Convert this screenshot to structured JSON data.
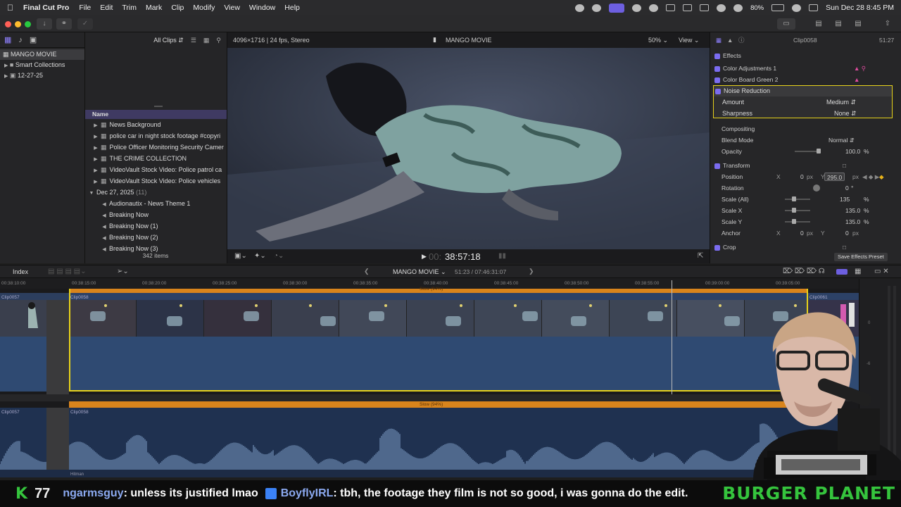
{
  "menubar": {
    "app_name": "Final Cut Pro",
    "items": [
      "File",
      "Edit",
      "Trim",
      "Mark",
      "Clip",
      "Modify",
      "View",
      "Window",
      "Help"
    ],
    "battery": "80%",
    "datetime": "Sun Dec 28  8:45 PM"
  },
  "library": {
    "name": "MANGO MOVIE",
    "items": [
      {
        "label": "Smart Collections"
      },
      {
        "label": "12-27-25"
      }
    ]
  },
  "browser": {
    "filter": "All Clips",
    "column_header": "Name",
    "rows": [
      {
        "label": "News Background",
        "type": "clip"
      },
      {
        "label": "police  car in night stock footage #copyri",
        "type": "clip"
      },
      {
        "label": "Police Officer Monitoring Security Camer",
        "type": "clip"
      },
      {
        "label": "THE CRIME COLLECTION",
        "type": "clip"
      },
      {
        "label": "VideoVault Stock Video:   Police patrol ca",
        "type": "clip"
      },
      {
        "label": "VideoVault Stock Video:   Police vehicles",
        "type": "clip"
      },
      {
        "label": "Dec 27, 2025",
        "count": "(11)",
        "type": "group"
      },
      {
        "label": "Audionautix - News Theme 1",
        "type": "audio"
      },
      {
        "label": "Breaking Now",
        "type": "audio"
      },
      {
        "label": "Breaking Now (1)",
        "type": "audio"
      },
      {
        "label": "Breaking Now (2)",
        "type": "audio"
      },
      {
        "label": "Breaking Now (3)",
        "type": "audio"
      }
    ],
    "item_count": "342 items"
  },
  "viewer": {
    "format": "4096×1716 | 24 fps, Stereo",
    "project": "MANGO MOVIE",
    "zoom": "50%",
    "view_label": "View",
    "timecode_dim": "00:",
    "timecode": "38:57:18"
  },
  "inspector": {
    "clip_name": "Clip0058",
    "clip_duration": "51:27",
    "sections": {
      "effects": "Effects",
      "color_adjustments": "Color Adjustments 1",
      "color_board": "Color Board Green 2",
      "noise_reduction": "Noise Reduction",
      "amount_label": "Amount",
      "amount_value": "Medium",
      "sharpness_label": "Sharpness",
      "sharpness_value": "None",
      "compositing": "Compositing",
      "blend_label": "Blend Mode",
      "blend_value": "Normal",
      "opacity_label": "Opacity",
      "opacity_value": "100.0",
      "transform": "Transform",
      "position_label": "Position",
      "pos_x": "0",
      "pos_y": "295.0",
      "rotation_label": "Rotation",
      "rotation_value": "0",
      "scale_all_label": "Scale (All)",
      "scale_all_value": "135",
      "scale_x_label": "Scale X",
      "scale_x_value": "135.0",
      "scale_y_label": "Scale Y",
      "scale_y_value": "135.0",
      "anchor_label": "Anchor",
      "anchor_x": "0",
      "anchor_y": "0",
      "crop": "Crop",
      "save_preset": "Save Effects Preset"
    },
    "units": {
      "px": "px",
      "pct": "%",
      "deg": "°",
      "x": "X",
      "y": "Y"
    }
  },
  "timeline": {
    "index_label": "Index",
    "project": "MANGO MOVIE",
    "duration": "51:23 / 07:46:31:07",
    "ruler": [
      "00:38:10:00",
      "00:38:15:00",
      "00:38:20:00",
      "00:38:25:00",
      "00:38:30:00",
      "00:38:35:00",
      "00:38:40:00",
      "00:38:45:00",
      "00:38:50:00",
      "00:38:55:00",
      "00:39:00:00",
      "00:39:05:00"
    ],
    "speed_label": "Slow (94%)",
    "clip_prev": "Clip0057",
    "clip_main": "Clip0058",
    "clip_next": "Clip0061",
    "audio_clip_prev": "Clip0057",
    "audio_clip_main": "Clip0058",
    "music_label": "Hitman",
    "meter_labels": [
      "0",
      "-6"
    ]
  },
  "chat": {
    "count_icon": "K",
    "count": "77",
    "msg1_user": "ngarmsguy",
    "msg1_text": ": unless its justified lmao",
    "msg2_user": "BoyflyIRL",
    "msg2_text": ": tbh, the footage they film is not so good, i was gonna do the edit.",
    "brand": "BURGER PLANET"
  },
  "colors": {
    "accent": "#7b6cf0",
    "selection_yellow": "#e7d21a",
    "speed_orange": "#d8841c",
    "clip_blue": "#2f4a72",
    "chat_green": "#35c43d",
    "chat_user": "#8ba9f0"
  }
}
